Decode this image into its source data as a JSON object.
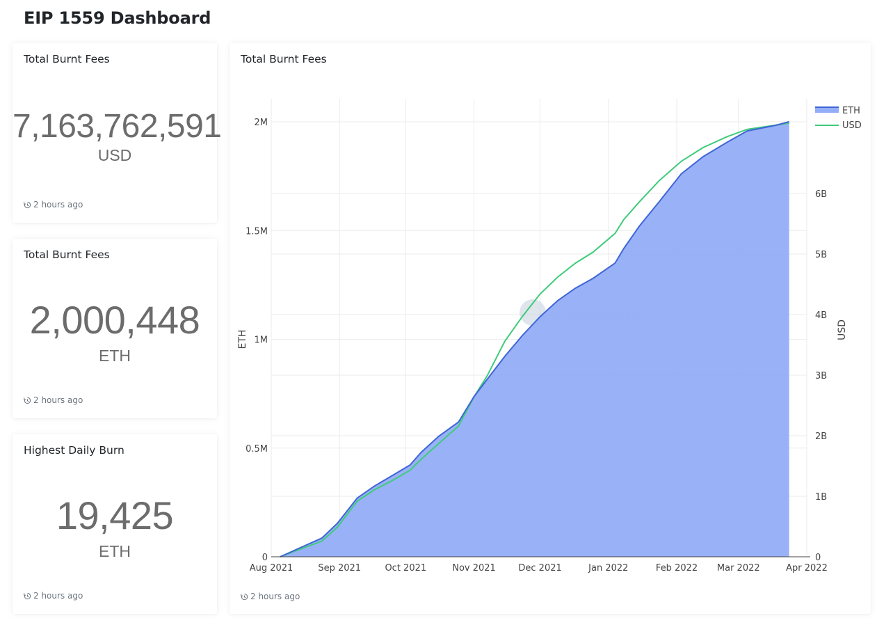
{
  "page": {
    "title": "EIP 1559 Dashboard"
  },
  "stats": [
    {
      "title": "Total Burnt Fees",
      "value": "7,163,762,591",
      "unit": "USD",
      "updated": "2 hours ago"
    },
    {
      "title": "Total Burnt Fees",
      "value": "2,000,448",
      "unit": "ETH",
      "updated": "2 hours ago"
    },
    {
      "title": "Highest Daily Burn",
      "value": "19,425",
      "unit": "ETH",
      "updated": "2 hours ago"
    }
  ],
  "chart_card": {
    "title": "Total Burnt Fees",
    "updated": "2 hours ago",
    "watermark": "Etherscan"
  },
  "colors": {
    "eth_line": "#3f66d6",
    "eth_fill": "#93adf7",
    "usd_line": "#3fcb7a"
  },
  "chart_data": {
    "type": "area",
    "title": "Total Burnt Fees",
    "xlabel": "",
    "ylabel": "ETH",
    "y2label": "USD",
    "x_ticks": [
      "Aug 2021",
      "Sep 2021",
      "Oct 2021",
      "Nov 2021",
      "Dec 2021",
      "Jan 2022",
      "Feb 2022",
      "Mar 2022",
      "Apr 2022"
    ],
    "x_range": [
      "2021-08-01",
      "2022-04-01"
    ],
    "y_ticks": [
      "0",
      "0.5M",
      "1M",
      "1.5M",
      "2M"
    ],
    "y_range": [
      0,
      2000000
    ],
    "y2_ticks": [
      "0",
      "1B",
      "2B",
      "3B",
      "4B",
      "5B",
      "6B"
    ],
    "y2_range": [
      0,
      7183000000
    ],
    "grid": true,
    "legend_position": "top-right",
    "x": [
      "2021-08-05",
      "2021-08-24",
      "2021-08-31",
      "2021-09-09",
      "2021-09-17",
      "2021-09-25",
      "2021-10-03",
      "2021-10-08",
      "2021-10-16",
      "2021-10-25",
      "2021-11-01",
      "2021-11-07",
      "2021-11-15",
      "2021-11-23",
      "2021-12-01",
      "2021-12-09",
      "2021-12-17",
      "2021-12-25",
      "2022-01-04",
      "2022-01-08",
      "2022-01-15",
      "2022-01-24",
      "2022-02-03",
      "2022-02-13",
      "2022-02-24",
      "2022-03-05",
      "2022-03-18",
      "2022-03-24"
    ],
    "series": [
      {
        "name": "ETH",
        "axis": "left",
        "type": "area",
        "values": [
          0,
          86000,
          154000,
          270000,
          326000,
          374000,
          422000,
          480000,
          554000,
          620000,
          736000,
          816000,
          922000,
          1018000,
          1104000,
          1178000,
          1235000,
          1280000,
          1350000,
          1418000,
          1520000,
          1632000,
          1760000,
          1840000,
          1907000,
          1958000,
          1984000,
          2000448
        ]
      },
      {
        "name": "USD",
        "axis": "right",
        "type": "line",
        "values": [
          0,
          260000000,
          490000000,
          920000000,
          1110000000,
          1260000000,
          1430000000,
          1610000000,
          1870000000,
          2160000000,
          2640000000,
          2990000000,
          3560000000,
          3970000000,
          4340000000,
          4620000000,
          4850000000,
          5030000000,
          5340000000,
          5570000000,
          5860000000,
          6210000000,
          6530000000,
          6760000000,
          6940000000,
          7060000000,
          7130000000,
          7163762591
        ]
      }
    ]
  }
}
